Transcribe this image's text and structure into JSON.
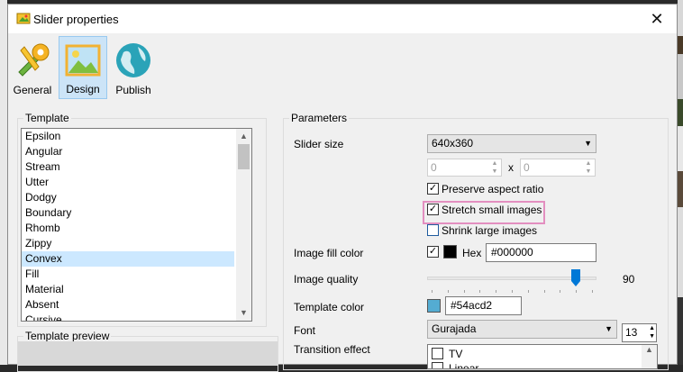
{
  "window": {
    "title": "Slider properties",
    "close_icon": "close-icon"
  },
  "toolbar": {
    "items": [
      {
        "label": "General",
        "icon": "tools-icon"
      },
      {
        "label": "Design",
        "icon": "picture-icon",
        "active": true
      },
      {
        "label": "Publish",
        "icon": "globe-icon"
      }
    ]
  },
  "template": {
    "group_title": "Template",
    "items": [
      "Epsilon",
      "Angular",
      "Stream",
      "Utter",
      "Dodgy",
      "Boundary",
      "Rhomb",
      "Zippy",
      "Convex",
      "Fill",
      "Material",
      "Absent",
      "Cursive"
    ],
    "selected": "Convex",
    "preview_title": "Template preview"
  },
  "parameters": {
    "group_title": "Parameters",
    "slider_size_label": "Slider size",
    "slider_size_value": "640x360",
    "width_value": "0",
    "size_separator": "x",
    "height_value": "0",
    "preserve_aspect": {
      "label": "Preserve aspect ratio",
      "checked": true
    },
    "stretch_small": {
      "label": "Stretch small images",
      "checked": true
    },
    "shrink_large": {
      "label": "Shrink large images",
      "checked": false
    },
    "fill_color_label": "Image fill color",
    "fill_color_checked": true,
    "fill_color_swatch": "#000000",
    "hex_label": "Hex",
    "hex_value": "#000000",
    "quality_label": "Image quality",
    "quality_value": "90",
    "quality_fraction": 0.9,
    "template_color_label": "Template color",
    "template_color_swatch": "#54acd2",
    "template_color_value": "#54acd2",
    "font_label": "Font",
    "font_value": "Gurajada",
    "font_size": "13",
    "transition_label": "Transition effect",
    "transitions": [
      "TV",
      "Linear"
    ]
  },
  "colors": {
    "selection": "#cce8ff",
    "accent": "#0078d7",
    "highlight": "#e38fc0"
  }
}
